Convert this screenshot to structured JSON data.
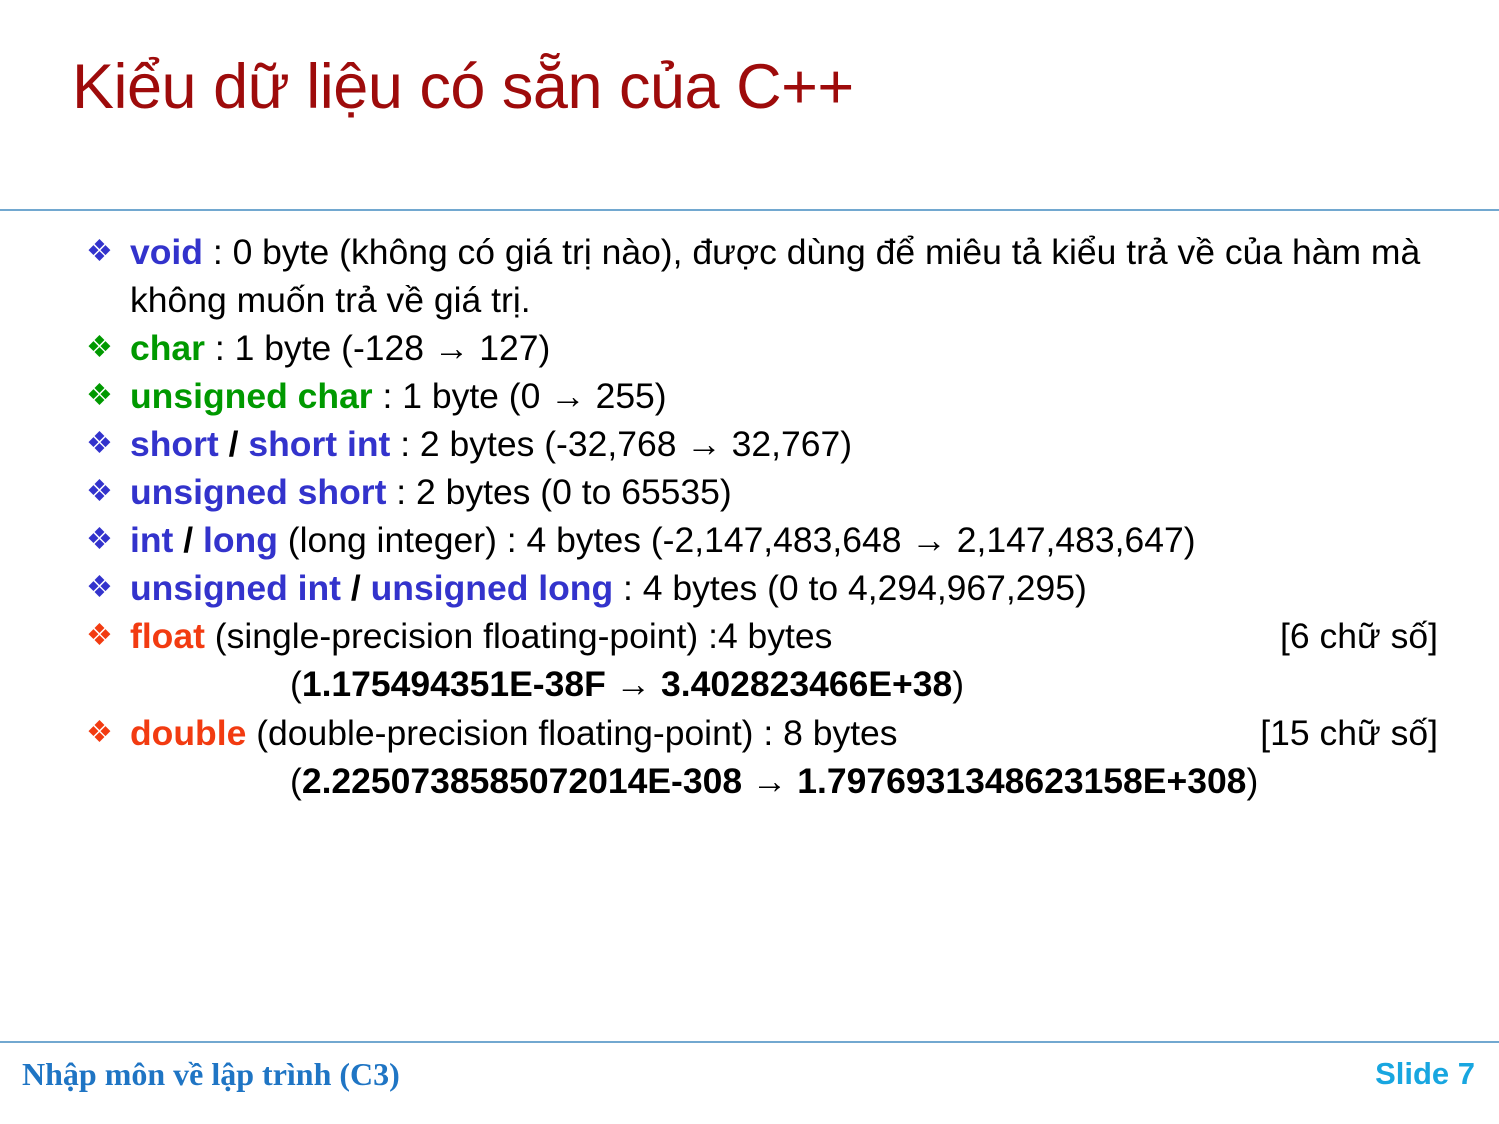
{
  "slide": {
    "title": "Kiểu dữ liệu có sẵn của C++",
    "title_color": "#9E0B0B",
    "rule_color": "#72A8D0",
    "bullet_glyph": "❖",
    "arrow_glyph": "→",
    "colors": {
      "blue": "#3333CC",
      "green": "#009900",
      "orange": "#F23B11",
      "black": "#000000",
      "footer_left": "#1F75C4",
      "footer_right": "#18A6E0"
    }
  },
  "items": [
    {
      "keyword": "void",
      "keyword_color": "blue",
      "separator": "",
      "keyword2": "",
      "rest": " : 0 byte (không có giá trị nào), được dùng để miêu tả kiểu trả về của hàm mà không muốn trả về giá trị.",
      "cont": "",
      "note": ""
    },
    {
      "keyword": "char",
      "keyword_color": "green",
      "separator": "",
      "keyword2": "",
      "rest": " : 1 byte (-128 → 127)",
      "cont": "",
      "note": ""
    },
    {
      "keyword": "unsigned char",
      "keyword_color": "green",
      "separator": "",
      "keyword2": "",
      "rest": " : 1 byte (0 → 255)",
      "cont": "",
      "note": ""
    },
    {
      "keyword": "short",
      "keyword_color": "blue",
      "separator": " / ",
      "keyword2": "short int",
      "rest": " : 2 bytes (-32,768 → 32,767)",
      "cont": "",
      "note": ""
    },
    {
      "keyword": "unsigned short",
      "keyword_color": "blue",
      "separator": "",
      "keyword2": "",
      "rest": " : 2 bytes (0 to 65535)",
      "cont": "",
      "note": ""
    },
    {
      "keyword": "int",
      "keyword_color": "blue",
      "separator": " / ",
      "keyword2": "long",
      "rest": " (long integer) : 4 bytes (-2,147,483,648 → 2,147,483,647)",
      "cont": "",
      "note": ""
    },
    {
      "keyword": "unsigned int",
      "keyword_color": "blue",
      "separator": " / ",
      "keyword2": "unsigned long",
      "rest": " : 4 bytes (0 to 4,294,967,295)",
      "cont": "",
      "note": ""
    },
    {
      "keyword": "float",
      "keyword_color": "orange",
      "separator": "",
      "keyword2": "",
      "rest": " (single-precision floating-point) :4 bytes",
      "cont_prefix": "(",
      "cont_value": "1.175494351E-38F → 3.402823466E+38",
      "cont_suffix": ")",
      "note": "[6 chữ số]"
    },
    {
      "keyword": "double",
      "keyword_color": "orange",
      "separator": "",
      "keyword2": "",
      "rest": " (double-precision floating-point) : 8 bytes",
      "cont_prefix": "(",
      "cont_value": "2.2250738585072014E-308  →  1.7976931348623158E+308",
      "cont_suffix": ")",
      "note": "[15 chữ số]"
    }
  ],
  "footer": {
    "left": "Nhập môn về lập trình (C3)",
    "right": "Slide 7"
  }
}
